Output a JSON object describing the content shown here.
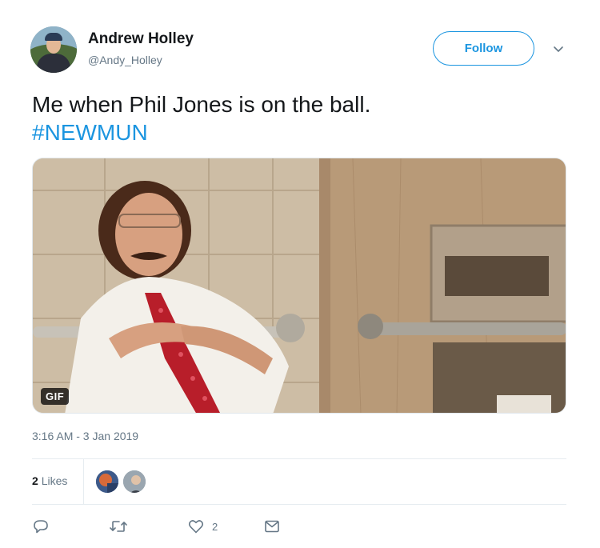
{
  "author": {
    "display_name": "Andrew Holley",
    "handle": "@Andy_Holley"
  },
  "follow_label": "Follow",
  "tweet_text": "Me when Phil Jones is on the ball.",
  "hashtag": "#NEWMUN",
  "media": {
    "badge": "GIF"
  },
  "timestamp": "3:16 AM - 3 Jan 2019",
  "likes": {
    "count": "2",
    "label": "Likes"
  },
  "actions": {
    "like_count": "2"
  },
  "icons": [
    "chevron-down-icon",
    "reply-icon",
    "retweet-icon",
    "heart-icon",
    "message-icon"
  ],
  "colors": {
    "accent": "#1b95e0",
    "secondary_text": "#657786",
    "divider": "#e6ecf0"
  }
}
